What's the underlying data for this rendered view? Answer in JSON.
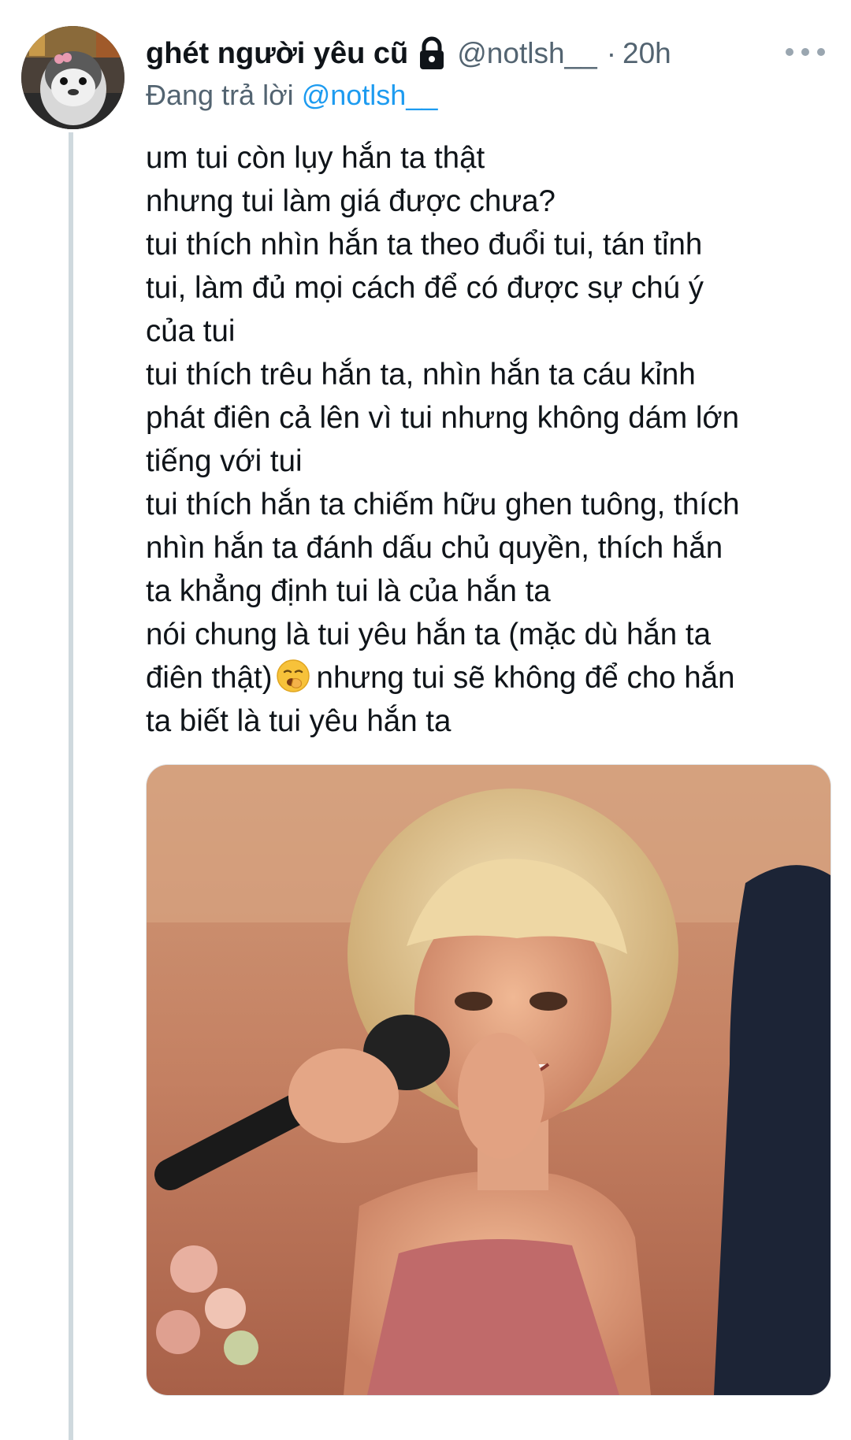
{
  "tweet": {
    "display_name": "ghét người yêu cũ",
    "handle": "@notlsh__",
    "separator": "·",
    "time": "20h",
    "reply_prefix": "Đang trả lời",
    "reply_handle": "@notlsh__",
    "protected_icon": "lock-icon",
    "menu_icon": "more-dots-icon",
    "avatar_icon": "penguin-plush-avatar",
    "emoji": "yawning-face-emoji",
    "text_lines": [
      "um tui còn lụy hắn ta thật",
      "nhưng tui làm giá được chưa?",
      "tui thích nhìn hắn ta theo đuổi tui, tán tỉnh",
      "tui, làm đủ mọi cách để có được sự chú ý",
      "của tui",
      "tui thích trêu hắn ta, nhìn hắn ta cáu kỉnh",
      "phát điên cả lên vì tui nhưng không dám lớn",
      "tiếng với tui",
      "tui thích hắn ta chiếm hữu ghen tuông, thích",
      "nhìn hắn ta đánh dấu chủ quyền, thích hắn",
      "ta khẳng định tui là của hắn ta",
      "nói chung là tui yêu hắn ta (mặc dù hắn ta",
      "điên thật)",
      "nhưng tui sẽ không để cho hắn",
      "ta biết là tui yêu hắn ta"
    ],
    "media": "photo-woman-with-microphone"
  },
  "colors": {
    "text": "#0f1419",
    "secondary": "#536471",
    "link": "#1d9bf0",
    "thread_line": "#cfd9de"
  }
}
